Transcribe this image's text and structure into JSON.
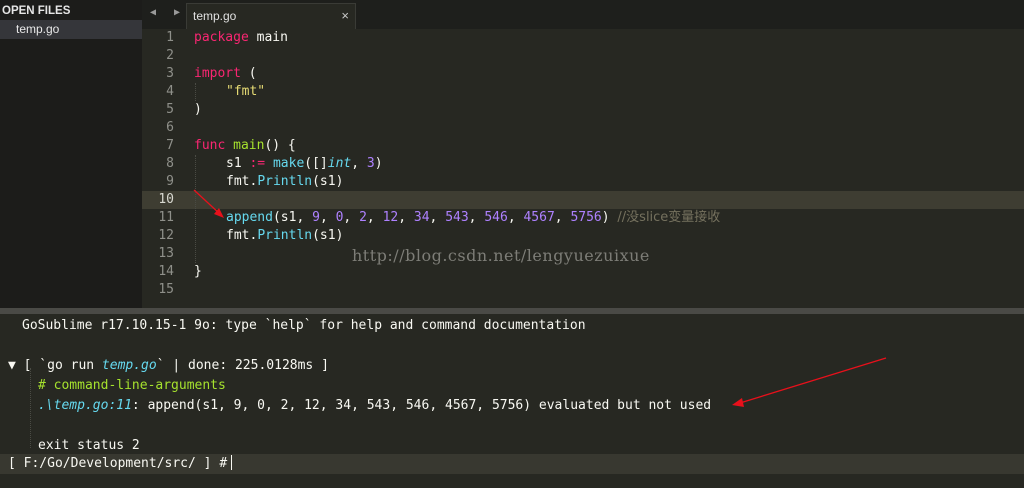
{
  "sidebar": {
    "header": "OPEN FILES",
    "files": [
      "temp.go"
    ]
  },
  "tabs": {
    "nav_arrows": "◀ ▶",
    "active": {
      "label": "temp.go",
      "close": "×"
    }
  },
  "editor": {
    "current_line": 10,
    "lines": [
      {
        "n": "1"
      },
      {
        "n": "2"
      },
      {
        "n": "3"
      },
      {
        "n": "4"
      },
      {
        "n": "5"
      },
      {
        "n": "6"
      },
      {
        "n": "7"
      },
      {
        "n": "8"
      },
      {
        "n": "9"
      },
      {
        "n": "10"
      },
      {
        "n": "11"
      },
      {
        "n": "12"
      },
      {
        "n": "13"
      },
      {
        "n": "14"
      },
      {
        "n": "15"
      }
    ],
    "code": {
      "l1": [
        "package",
        " main"
      ],
      "l3": [
        "import",
        " ("
      ],
      "l4": "\"fmt\"",
      "l5": ")",
      "l7": [
        "func",
        " ",
        "main",
        "() {"
      ],
      "l8": [
        "s1",
        " := ",
        "make",
        "([]",
        "int",
        ", ",
        "3",
        ")"
      ],
      "l9": [
        "fmt.",
        "Println",
        "(s1)"
      ],
      "l11": [
        "append",
        "(s1, ",
        "9",
        ", ",
        "0",
        ", ",
        "2",
        ", ",
        "12",
        ", ",
        "34",
        ", ",
        "543",
        ", ",
        "546",
        ", ",
        "4567",
        ", ",
        "5756",
        ") ",
        "//没slice变量接收"
      ],
      "l12": [
        "fmt.",
        "Println",
        "(s1)"
      ],
      "l14": "}"
    },
    "watermark": "http://blog.csdn.net/lengyuezuixue"
  },
  "console": {
    "banner": "GoSublime r17.10.15-1 9o: type `help` for help and command documentation",
    "run_prefix": "▼ [ `go run ",
    "run_file": "temp.go",
    "run_suffix": "` | done: 225.0128ms ]",
    "comment": "# command-line-arguments",
    "err_loc": ".\\temp.go:11",
    "err_msg": ": append(s1, 9, 0, 2, 12, 34, 543, 546, 4567, 5756) evaluated but not used",
    "exit": "exit status 2",
    "prompt_path": "[ F:/Go/Development/src/ ]",
    "prompt_hash": "#"
  },
  "colors": {
    "background": "#272822",
    "keyword": "#f92672",
    "function": "#66d9ef",
    "string": "#e6db74",
    "number": "#ae81ff",
    "annotation_arrow": "#e8101b"
  }
}
